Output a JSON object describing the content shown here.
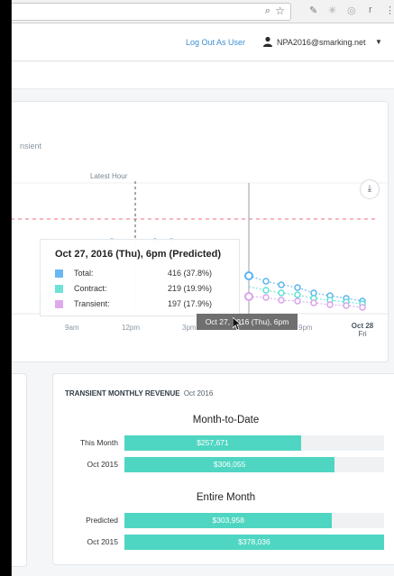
{
  "browser": {
    "zoom_icon": "magnifier-icon",
    "star_icon": "star-icon",
    "extensions": [
      "pen-icon",
      "snowflake-icon",
      "circle-icon",
      "r-icon",
      "menu-dots-icon"
    ]
  },
  "header": {
    "logout_label": "Log Out As User",
    "user_email": "NPA2016@smarking.net",
    "user_icon": "user-icon",
    "caret_icon": "caret-down-icon"
  },
  "chart_card": {
    "subtitle_partial": "nsient",
    "latest_hour_label": "Latest Hour",
    "download_icon": "download-icon",
    "x_ticks": [
      "9am",
      "12pm",
      "3pm",
      "9pm"
    ],
    "x_last_tick": {
      "line1": "Oct 28",
      "line2": "Fri"
    },
    "hover_tip": "Oct 27, 2016 (Thu), 6pm",
    "colors": {
      "total": "#5bb4f0",
      "contract": "#5fe0d3",
      "transient": "#d9a3ec",
      "threshold": "#f06b7c"
    }
  },
  "tooltip": {
    "title": "Oct 27, 2016 (Thu), 6pm (Predicted)",
    "rows": [
      {
        "label": "Total:",
        "value": "416 (37.8%)",
        "color": "#6ab8f2"
      },
      {
        "label": "Contract:",
        "value": "219 (19.9%)",
        "color": "#6de3d5"
      },
      {
        "label": "Transient:",
        "value": "197 (17.9%)",
        "color": "#dfa9ee"
      }
    ]
  },
  "revenue": {
    "title": "TRANSIENT MONTHLY REVENUE",
    "date": "Oct 2016",
    "month_to_date": {
      "heading": "Month-to-Date",
      "bars": [
        {
          "label": "This Month",
          "value": "$257,671",
          "fraction": 0.68
        },
        {
          "label": "Oct 2015",
          "value": "$306,055",
          "fraction": 0.81
        }
      ]
    },
    "entire_month": {
      "heading": "Entire Month",
      "bars": [
        {
          "label": "Predicted",
          "value": "$303,958",
          "fraction": 0.8
        },
        {
          "label": "Oct 2015",
          "value": "$378,036",
          "fraction": 1.0
        }
      ]
    },
    "bar_color": "#4fd6c2"
  }
}
